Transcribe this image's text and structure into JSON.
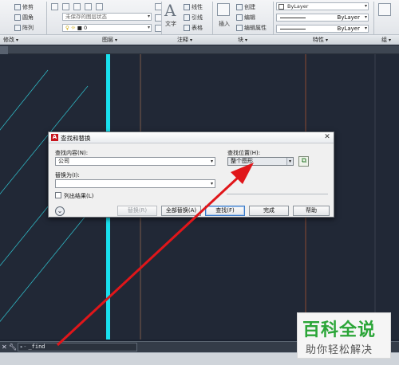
{
  "ribbon": {
    "layer_items": [
      "修剪",
      "圆角",
      "阵列"
    ],
    "layer_dropdown": "未保存的图层状态",
    "layer_current": "0",
    "panels": {
      "modify": "修改",
      "layers": "图层",
      "annotation": "注释",
      "block": "块",
      "properties": "特性",
      "groups": "组"
    },
    "annotation": {
      "text": "文字",
      "items": [
        "线性",
        "引线",
        "表格"
      ]
    },
    "block": {
      "insert": "插入",
      "items": [
        "创建",
        "编辑",
        "编辑属性"
      ]
    },
    "properties": {
      "color": "ByLayer",
      "linetype": "ByLayer",
      "lineweight": "ByLayer"
    }
  },
  "dialog": {
    "title": "查找和替换",
    "find_label": "查找内容(N):",
    "find_value": "公司",
    "replace_label": "替换为(I):",
    "replace_value": "",
    "where_label": "查找位置(H):",
    "where_value": "整个图形",
    "list_results": "列出结果(L)",
    "expand_icon": "chevron-down-icon",
    "buttons": {
      "replace": "替换(R)",
      "replace_all": "全部替换(A)",
      "find": "查找(F)",
      "done": "完成",
      "help": "帮助"
    }
  },
  "command": {
    "prompt": "▸-",
    "input": "_find"
  },
  "watermark": {
    "main": "百科全说",
    "sub": "助你轻松解决"
  },
  "colors": {
    "canvas_bg": "#212836",
    "cyan_line": "#19e0ee",
    "arrow": "#e0161a",
    "brown_line": "#7a4a3a"
  }
}
